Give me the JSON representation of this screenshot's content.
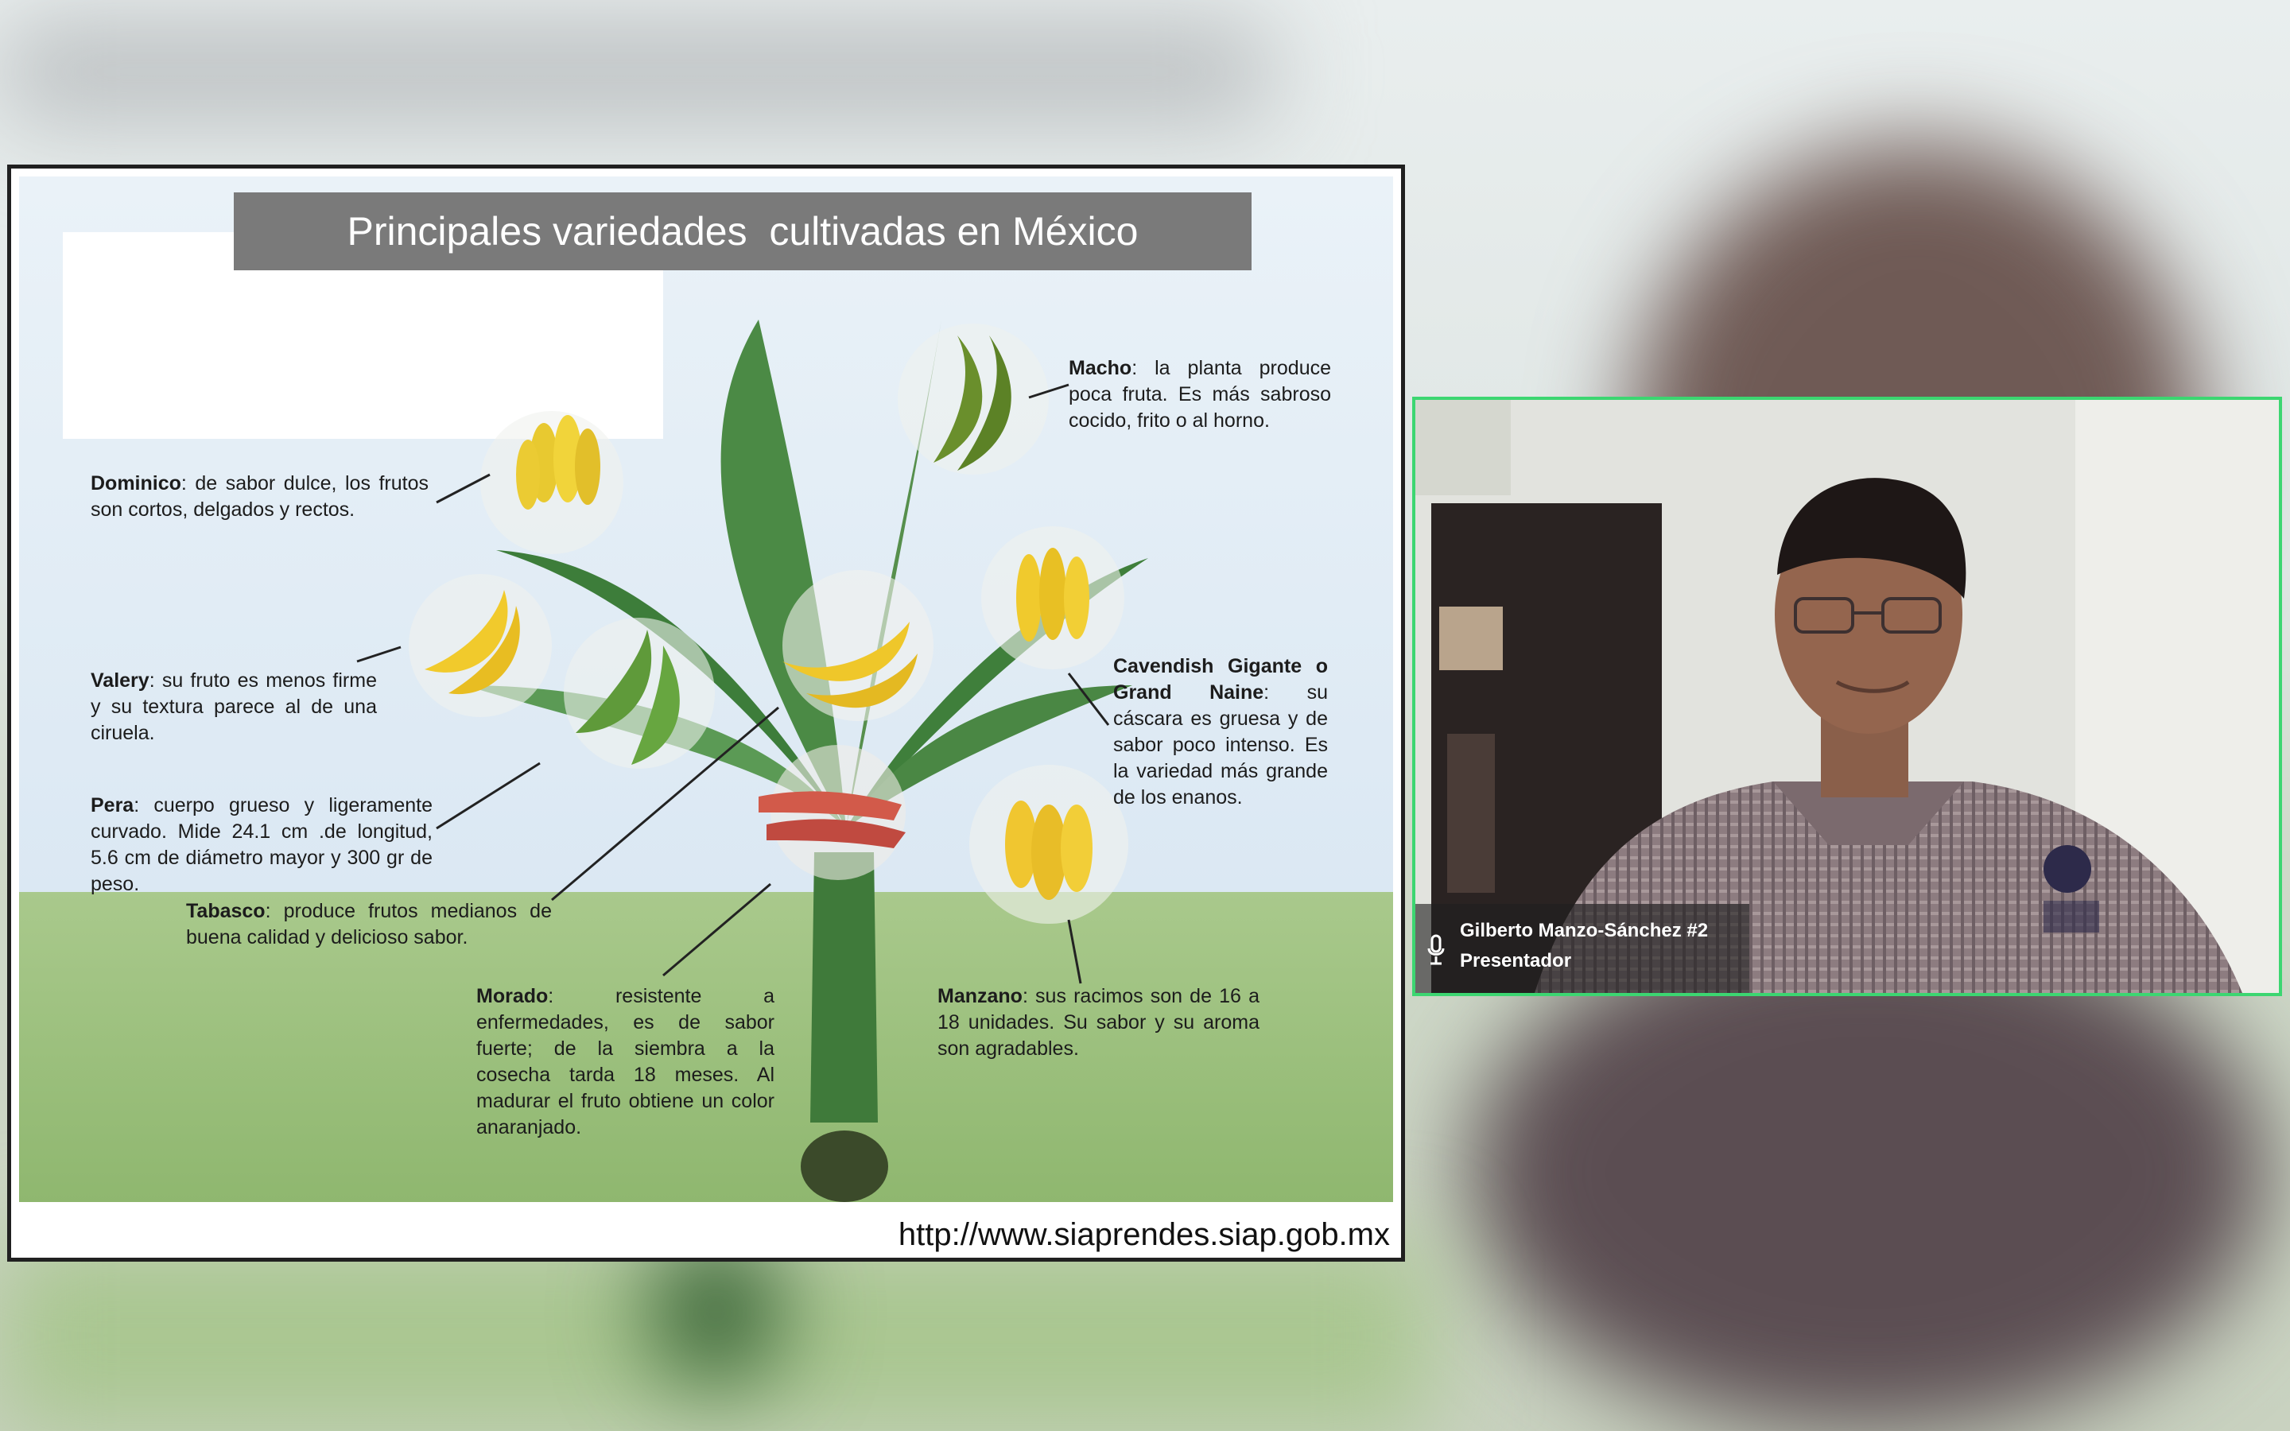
{
  "slide": {
    "title": "Principales variedades  cultivadas en México",
    "credit": "http://www.siaprendes.siap.gob.mx",
    "varieties": {
      "macho": {
        "name": "Macho",
        "desc": ": la planta produce poca fruta. Es más sabroso cocido, frito o al horno."
      },
      "dominico": {
        "name": "Dominico",
        "desc": ": de sabor dulce, los frutos son cortos, delgados y rectos."
      },
      "valery": {
        "name": "Valery",
        "desc": ": su fruto es menos firme y su textura parece al de una ciruela."
      },
      "pera": {
        "name": "Pera",
        "desc": ": cuerpo grueso y ligeramente curvado. Mide 24.1 cm .de longitud, 5.6 cm de diámetro mayor y 300 gr de peso."
      },
      "tabasco": {
        "name": "Tabasco",
        "desc": ": produce frutos medianos de buena calidad y delicioso sabor."
      },
      "cavendish": {
        "name": "Cavendish Gigante o Grand Naine",
        "desc": ": su cáscara es gruesa y de sabor poco intenso. Es la variedad más grande de los enanos."
      },
      "morado": {
        "name": "Morado",
        "desc": ": resistente a enfermedades, es de sabor fuerte; de la siembra a la cosecha tarda 18 meses. Al madurar el fruto obtiene un color anaranjado."
      },
      "manzano": {
        "name": "Manzano",
        "desc": ": sus racimos son de 16 a 18 unidades. Su sabor y su aroma son agradables."
      }
    }
  },
  "participant": {
    "name": "Gilberto Manzo-Sánchez #2",
    "role": "Presentador"
  },
  "colors": {
    "active_speaker_border": "#3cd671",
    "title_bar": "#7a7a7a"
  }
}
